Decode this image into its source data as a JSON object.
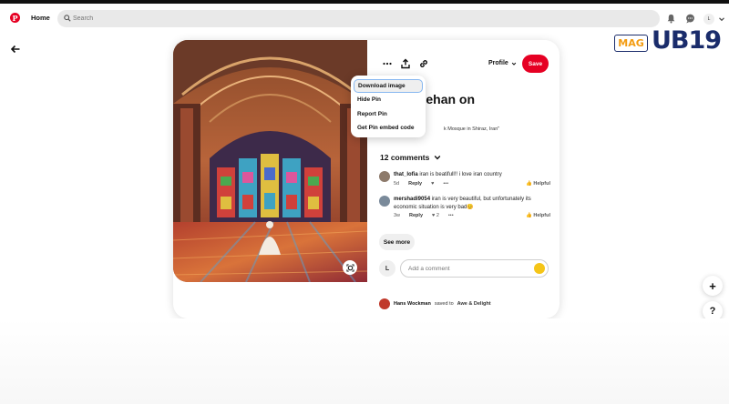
{
  "header": {
    "logo_letter": "P",
    "home_label": "Home",
    "search_placeholder": "Search",
    "avatar_initial": "L"
  },
  "toolbar": {
    "more_icon": "more-dots-icon",
    "share_icon": "share-icon",
    "link_icon": "link-icon",
    "profile_label": "Profile",
    "save_label": "Save"
  },
  "dropdown": {
    "items": [
      {
        "label": "Download image"
      },
      {
        "label": "Hide Pin"
      },
      {
        "label": "Report Pin"
      },
      {
        "label": "Get Pin embed code"
      }
    ]
  },
  "pin": {
    "title_visible": "nlar Jehan on",
    "description_visible": "k Mosque in Shiraz, Iran\""
  },
  "comments": {
    "count_label": "12 comments",
    "items": [
      {
        "user": "that_lofia",
        "text": "iran is beatifull!! i love iran country",
        "age": "5d",
        "reply": "Reply",
        "likes": "",
        "helpful": "Helpful"
      },
      {
        "user": "mershadi9054",
        "text": "iran is very beautiful, but unfortunately its economic situation is very bad",
        "age": "3w",
        "reply": "Reply",
        "likes": "2",
        "helpful": "Helpful"
      }
    ],
    "see_more_label": "See more",
    "add_avatar_initial": "L",
    "add_placeholder": "Add a comment"
  },
  "saved": {
    "user": "Hans Wockman",
    "mid": "saved to",
    "board": "Awe & Delight"
  },
  "watermark": {
    "mag": "MAG",
    "word": "UB19"
  },
  "fabs": {
    "plus": "+",
    "help": "?"
  },
  "colors": {
    "brand_red": "#e60023",
    "search_bg": "#e9e9e9",
    "mag_navy": "#1a2c6b",
    "mag_orange": "#f39c12"
  }
}
